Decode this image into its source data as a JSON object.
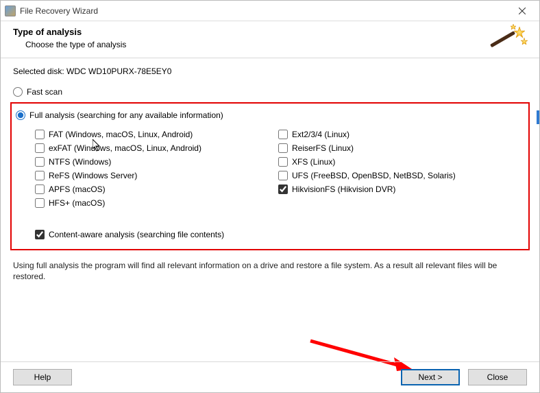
{
  "window": {
    "title": "File Recovery Wizard"
  },
  "header": {
    "title": "Type of analysis",
    "subtitle": "Choose the type of analysis"
  },
  "selected_disk": {
    "label": "Selected disk: WDC WD10PURX-78E5EY0"
  },
  "radios": {
    "fast": "Fast scan",
    "full": "Full analysis (searching for any available information)"
  },
  "fs_left": [
    "FAT (Windows, macOS, Linux, Android)",
    "exFAT (Windows, macOS, Linux, Android)",
    "NTFS (Windows)",
    "ReFS (Windows Server)",
    "APFS (macOS)",
    "HFS+ (macOS)"
  ],
  "fs_right": [
    "Ext2/3/4 (Linux)",
    "ReiserFS (Linux)",
    "XFS (Linux)",
    "UFS (FreeBSD, OpenBSD, NetBSD, Solaris)",
    "HikvisionFS (Hikvision DVR)"
  ],
  "content_aware": "Content-aware analysis (searching file contents)",
  "hint": "Using full analysis the program will find all relevant information on a drive and restore a file system. As a result all relevant files will be restored.",
  "buttons": {
    "help": "Help",
    "next": "Next >",
    "close": "Close"
  }
}
